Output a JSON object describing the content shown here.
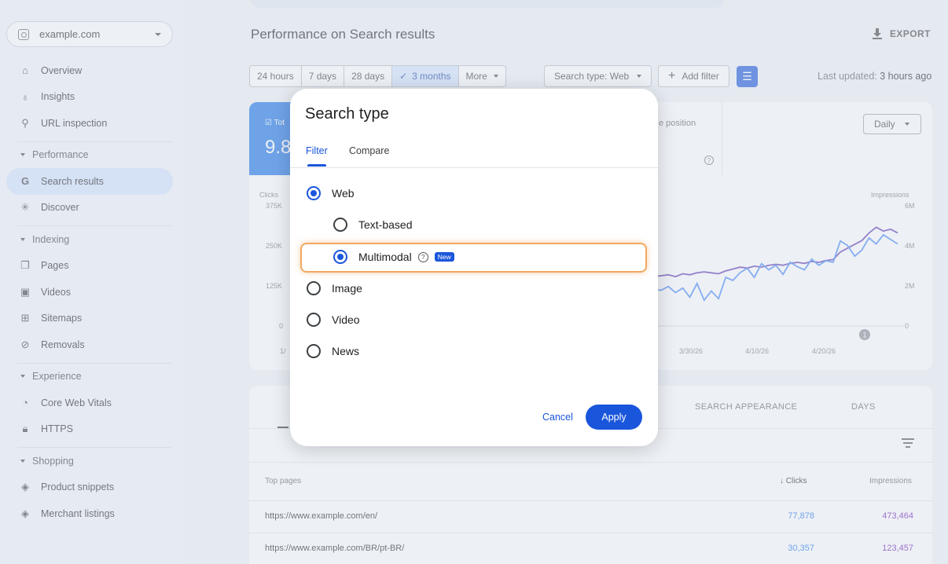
{
  "property": {
    "label": "example.com"
  },
  "sidebar": {
    "items": [
      {
        "label": "Overview",
        "icon": "home-icon"
      },
      {
        "label": "Insights",
        "icon": "lightbulb-icon"
      },
      {
        "label": "URL inspection",
        "icon": "search-icon"
      }
    ],
    "performance": {
      "header": "Performance",
      "items": [
        {
          "label": "Search results",
          "icon": "google-g-icon",
          "active": true
        },
        {
          "label": "Discover",
          "icon": "asterisk-icon"
        }
      ]
    },
    "indexing": {
      "header": "Indexing",
      "items": [
        {
          "label": "Pages",
          "icon": "pages-icon"
        },
        {
          "label": "Videos",
          "icon": "video-icon"
        },
        {
          "label": "Sitemaps",
          "icon": "sitemap-icon"
        },
        {
          "label": "Removals",
          "icon": "eye-off-icon"
        }
      ]
    },
    "experience": {
      "header": "Experience",
      "items": [
        {
          "label": "Core Web Vitals",
          "icon": "gauge-icon"
        },
        {
          "label": "HTTPS",
          "icon": "lock-icon"
        }
      ]
    },
    "shopping": {
      "header": "Shopping",
      "items": [
        {
          "label": "Product snippets",
          "icon": "layers-icon"
        },
        {
          "label": "Merchant listings",
          "icon": "layers-icon"
        }
      ]
    }
  },
  "header": {
    "title": "Performance on Search results",
    "export_label": "EXPORT"
  },
  "toolbar": {
    "date_ranges": [
      "24 hours",
      "7 days",
      "28 days",
      "3 months",
      "More"
    ],
    "selected_range": "3 months",
    "search_type": "Search type: Web",
    "add_filter": "Add filter",
    "last_updated_prefix": "Last updated:",
    "last_updated_value": "3 hours ago"
  },
  "chart": {
    "total_clicks_label": "Tot",
    "total_clicks_value": "9.8",
    "position_label": "e position",
    "granularity": "Daily",
    "left_axis_title": "Clicks",
    "left_ticks": [
      "375K",
      "250K",
      "125K",
      "0"
    ],
    "right_axis_title": "Impressions",
    "right_ticks": [
      "6M",
      "4M",
      "2M",
      "0"
    ],
    "x_ticks": [
      "1/",
      "3/30/26",
      "4/10/26",
      "4/20/26"
    ],
    "marker": "1",
    "colors": {
      "clicks": "#4285f4",
      "impressions": "#5e35b1"
    }
  },
  "chart_data": {
    "type": "line",
    "series": [
      {
        "name": "Clicks",
        "values": [
          120,
          118,
          130,
          110,
          125,
          95,
          140,
          85,
          115,
          90,
          160,
          150,
          175,
          190,
          160,
          205,
          185,
          200,
          170,
          210,
          195,
          185,
          220,
          200,
          215,
          210,
          280,
          265,
          230,
          250,
          290,
          270,
          300,
          285,
          270
        ]
      },
      {
        "name": "Impressions",
        "values": [
          2.6,
          2.65,
          2.7,
          2.6,
          2.75,
          2.7,
          2.8,
          2.85,
          2.8,
          2.75,
          2.9,
          3.0,
          3.1,
          3.05,
          3.15,
          3.1,
          3.2,
          3.25,
          3.2,
          3.3,
          3.35,
          3.3,
          3.4,
          3.35,
          3.45,
          3.5,
          3.9,
          4.1,
          4.3,
          4.5,
          4.9,
          5.2,
          5.0,
          5.1,
          4.9
        ]
      }
    ],
    "ylim_left": [
      0,
      375000
    ],
    "ylim_right": [
      0,
      6000000
    ]
  },
  "table": {
    "tabs": [
      "SEARCH APPEARANCE",
      "DAYS"
    ],
    "headers": {
      "pages": "Top pages",
      "clicks": "Clicks",
      "impressions": "Impressions"
    },
    "rows": [
      {
        "url": "https://www.example.com/en/",
        "clicks": "77,878",
        "impressions": "473,464"
      },
      {
        "url": "https://www.example.com/BR/pt-BR/",
        "clicks": "30,357",
        "impressions": "123,457"
      }
    ]
  },
  "dialog": {
    "title": "Search type",
    "tabs": [
      "Filter",
      "Compare"
    ],
    "options": {
      "web": "Web",
      "text_based": "Text-based",
      "multimodal": "Multimodal",
      "new_badge": "New",
      "image": "Image",
      "video": "Video",
      "news": "News"
    },
    "cancel": "Cancel",
    "apply": "Apply"
  }
}
